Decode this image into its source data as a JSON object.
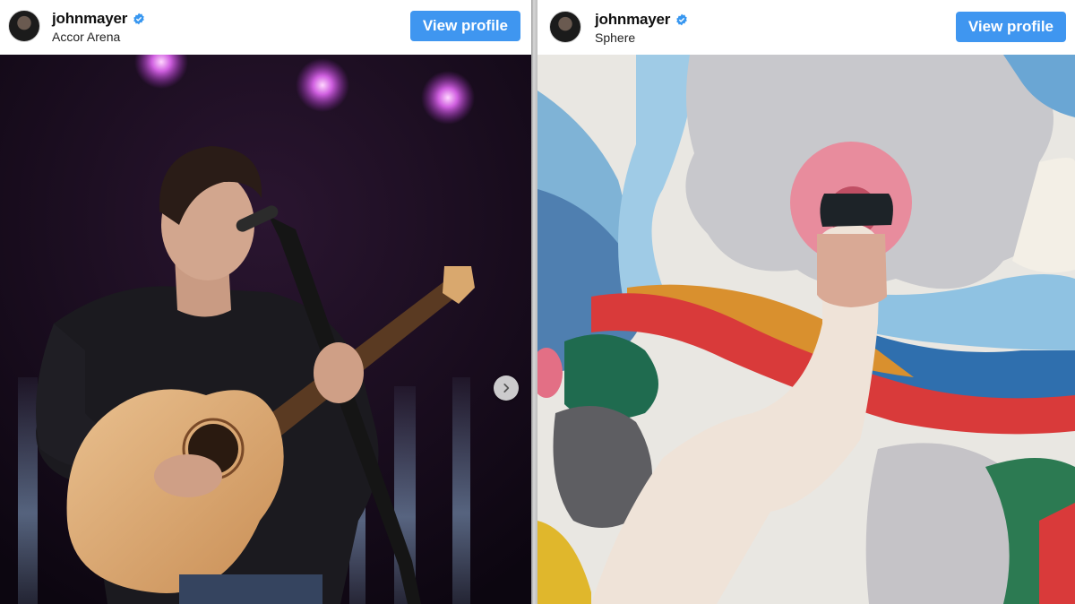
{
  "posts": [
    {
      "username": "johnmayer",
      "location": "Accor Arena",
      "view_profile_label": "View profile",
      "photo_icon": "concert-photo",
      "has_next": true
    },
    {
      "username": "johnmayer",
      "location": "Sphere",
      "view_profile_label": "View profile",
      "photo_icon": "rug-finger-photo"
    }
  ],
  "colors": {
    "button_blue": "#3f96f0",
    "verified_blue": "#3897f0"
  },
  "icons": {
    "verified": "verified-badge-icon",
    "next": "chevron-right-icon"
  }
}
